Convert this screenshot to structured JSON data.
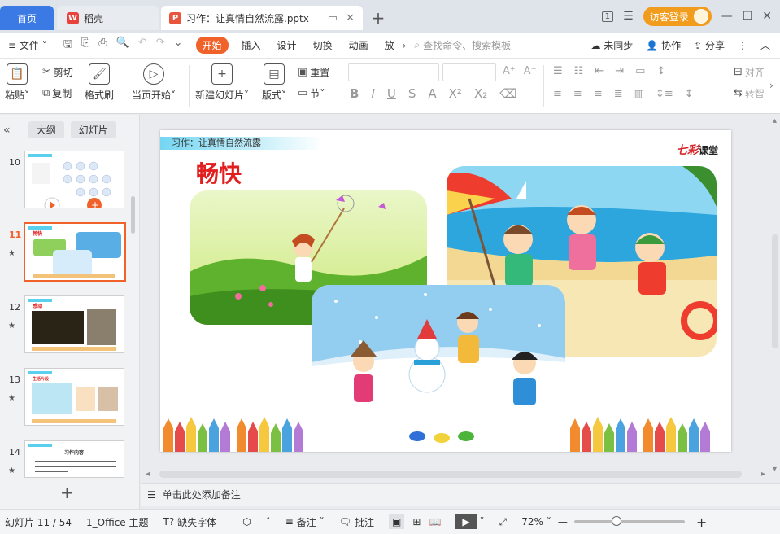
{
  "tabs": {
    "home": "首页",
    "daoke": "稻壳",
    "document": "习作：让真情自然流露.pptx",
    "add": "+"
  },
  "titlebar": {
    "page_indicator": "1",
    "visitor_login": "访客登录"
  },
  "menu": {
    "file": "文件",
    "items": [
      "开始",
      "插入",
      "设计",
      "切换",
      "动画",
      "放"
    ],
    "search_placeholder": "查找命令、搜索模板",
    "unsynced": "未同步",
    "collab": "协作",
    "share": "分享"
  },
  "ribbon": {
    "paste": "粘贴",
    "cut": "剪切",
    "copy": "复制",
    "format_painter": "格式刷",
    "from_current": "当页开始",
    "new_slide": "新建幻灯片",
    "layout": "版式",
    "reset": "重置",
    "section": "节",
    "align": "对齐",
    "convert": "转智"
  },
  "left_panel": {
    "outline_tab": "大纲",
    "slides_tab": "幻灯片",
    "thumbnails": [
      {
        "num": "10",
        "title": "",
        "star": false
      },
      {
        "num": "11",
        "title": "畅快",
        "star": true,
        "selected": true
      },
      {
        "num": "12",
        "title": "感动",
        "star": true
      },
      {
        "num": "13",
        "title": "生活片段",
        "star": true
      },
      {
        "num": "14",
        "title": "习作内容",
        "star": true
      }
    ]
  },
  "slide": {
    "banner": "习作：让真情自然流露",
    "brand_main": "七彩",
    "brand_sub": "课堂",
    "heading": "畅快"
  },
  "notes": {
    "placeholder": "单击此处添加备注"
  },
  "status": {
    "slide_count": "幻灯片 11 / 54",
    "theme": "1_Office 主题",
    "missing_font": "缺失字体",
    "notes": "备注",
    "comments": "批注",
    "zoom": "72%",
    "zoom_level": 0.38
  },
  "colors": {
    "accent": "#f0622a",
    "home_tab": "#3b79e5",
    "heading": "#e21e1e"
  }
}
